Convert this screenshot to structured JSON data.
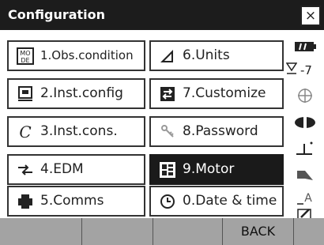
{
  "window": {
    "title": "Configuration",
    "close_label": "×"
  },
  "menu": [
    {
      "id": "obs",
      "label": "1.Obs.condition",
      "icon": "obs-condition-icon"
    },
    {
      "id": "units",
      "label": "6.Units",
      "icon": "triangle-units-icon"
    },
    {
      "id": "instconfig",
      "label": "2.Inst.config",
      "icon": "instrument-config-icon"
    },
    {
      "id": "customize",
      "label": "7.Customize",
      "icon": "customize-arrows-icon"
    },
    {
      "id": "instcons",
      "label": "3.Inst.cons.",
      "icon": "constant-c-icon"
    },
    {
      "id": "password",
      "label": "8.Password",
      "icon": "key-icon"
    },
    {
      "id": "edm",
      "label": "4.EDM",
      "icon": "edm-arrows-icon"
    },
    {
      "id": "motor",
      "label": "9.Motor",
      "icon": "motor-icon",
      "selected": true
    },
    {
      "id": "comms",
      "label": "5.Comms",
      "icon": "comms-icon"
    },
    {
      "id": "datetime",
      "label": "0.Date & time",
      "icon": "clock-icon"
    }
  ],
  "status": {
    "tilt_text": "-7"
  },
  "softkeys": [
    "",
    "",
    "",
    "BACK",
    ""
  ]
}
